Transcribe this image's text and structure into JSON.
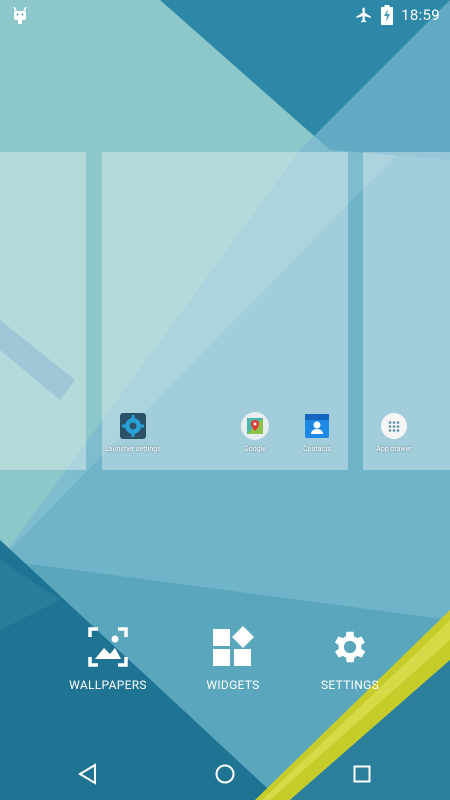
{
  "status_bar": {
    "time": "18:59",
    "icons": [
      "android-icon",
      "airplane-mode-icon",
      "battery-charging-icon"
    ]
  },
  "workspace": {
    "apps": [
      {
        "label": "Launcher settings",
        "icon": "gear-icon"
      },
      {
        "label": "Google",
        "icon": "google-maps-icon"
      },
      {
        "label": "Contacts",
        "icon": "contacts-icon"
      },
      {
        "label": "App drawer",
        "icon": "app-drawer-icon"
      }
    ]
  },
  "options": {
    "wallpapers": "WALLPAPERS",
    "widgets": "WIDGETS",
    "settings": "SETTINGS"
  },
  "nav": {
    "icons": [
      "back-icon",
      "home-icon",
      "recents-icon"
    ]
  },
  "colors": {
    "accent_yellow": "#c6cc2a",
    "teal": "#4a9bb3"
  }
}
